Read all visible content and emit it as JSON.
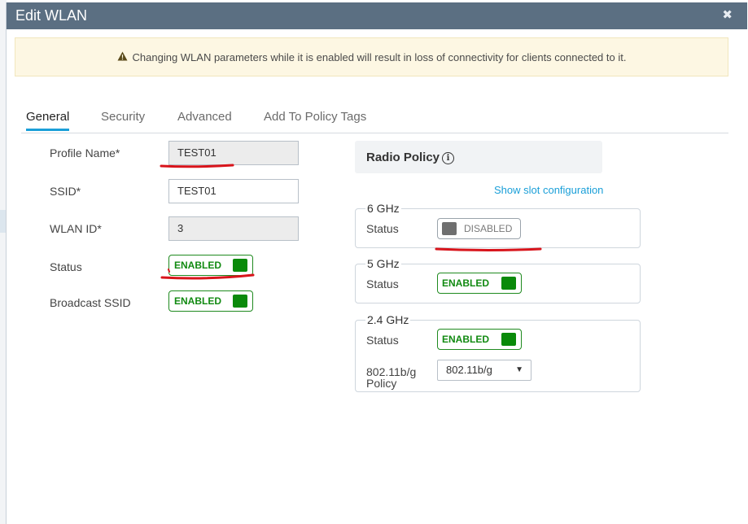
{
  "modal": {
    "title": "Edit WLAN",
    "close_glyph": "✖",
    "alert_icon": "warning-triangle-icon",
    "alert_text": "Changing WLAN parameters while it is enabled will result in loss of connectivity for clients connected to it."
  },
  "tabs": [
    {
      "label": "General",
      "active": true
    },
    {
      "label": "Security",
      "active": false
    },
    {
      "label": "Advanced",
      "active": false
    },
    {
      "label": "Add To Policy Tags",
      "active": false
    }
  ],
  "general": {
    "profile_name_label": "Profile Name*",
    "profile_name_value": "TEST01",
    "ssid_label": "SSID*",
    "ssid_value": "TEST01",
    "wlan_id_label": "WLAN ID*",
    "wlan_id_value": "3",
    "status_label": "Status",
    "status_value": "ENABLED",
    "broadcast_label": "Broadcast SSID",
    "broadcast_value": "ENABLED"
  },
  "radio_policy": {
    "title": "Radio Policy",
    "info_icon": "info-circle-icon",
    "show_slot_link": "Show slot configuration",
    "band_6": {
      "legend": "6 GHz",
      "status_label": "Status",
      "status_value": "DISABLED"
    },
    "band_5": {
      "legend": "5 GHz",
      "status_label": "Status",
      "status_value": "ENABLED"
    },
    "band_24": {
      "legend": "2.4 GHz",
      "status_label": "Status",
      "status_value": "ENABLED",
      "policy_label_1": "802.11b/g",
      "policy_label_2": "Policy",
      "policy_value": "802.11b/g"
    }
  },
  "colors": {
    "header_bg": "#5b6f82",
    "accent": "#1a9fd8",
    "enabled_green": "#0a8a0a",
    "annotation_red": "#d8141b",
    "alert_bg": "#fdf7e3"
  }
}
